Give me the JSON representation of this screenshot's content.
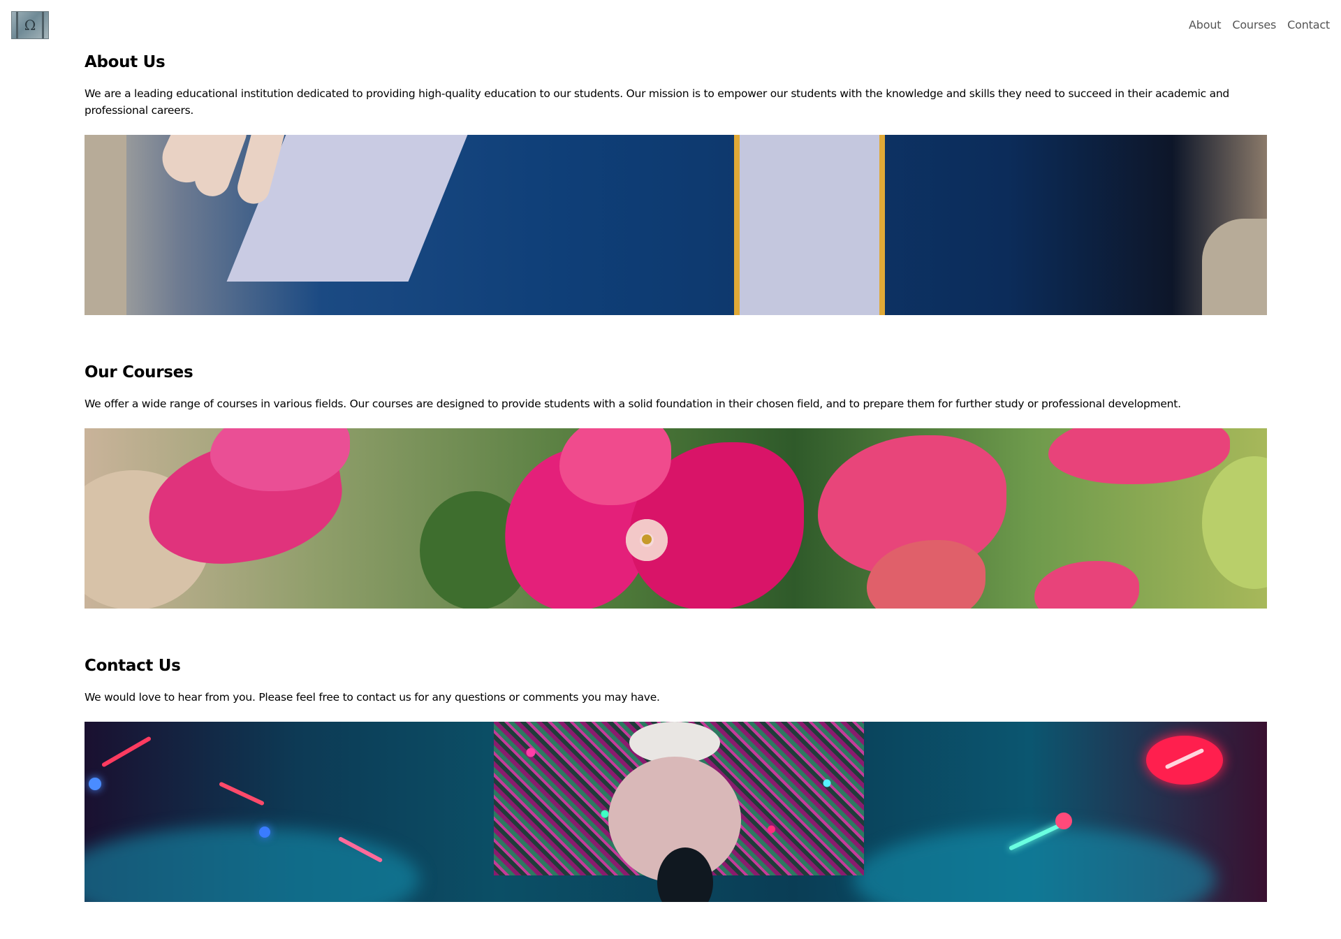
{
  "header": {
    "logo_alt": "Ω",
    "nav": [
      {
        "label": "About"
      },
      {
        "label": "Courses"
      },
      {
        "label": "Contact"
      }
    ]
  },
  "sections": [
    {
      "title": "About Us",
      "text": "We are a leading educational institution dedicated to providing high-quality education to our students. Our mission is to empower our students with the knowledge and skills they need to succeed in their academic and professional careers.",
      "image": "graduation-gown-photo"
    },
    {
      "title": "Our Courses",
      "text": "We offer a wide range of courses in various fields. Our courses are designed to provide students with a solid foundation in their chosen field, and to prepare them for further study or professional development.",
      "image": "bougainvillea-flowers-photo"
    },
    {
      "title": "Contact Us",
      "text": "We would love to hear from you. Please feel free to contact us for any questions or comments you may have.",
      "image": "concert-stage-photo"
    }
  ],
  "colors": {
    "background": "#ffffff",
    "text": "#000000",
    "nav_text": "#555555"
  }
}
